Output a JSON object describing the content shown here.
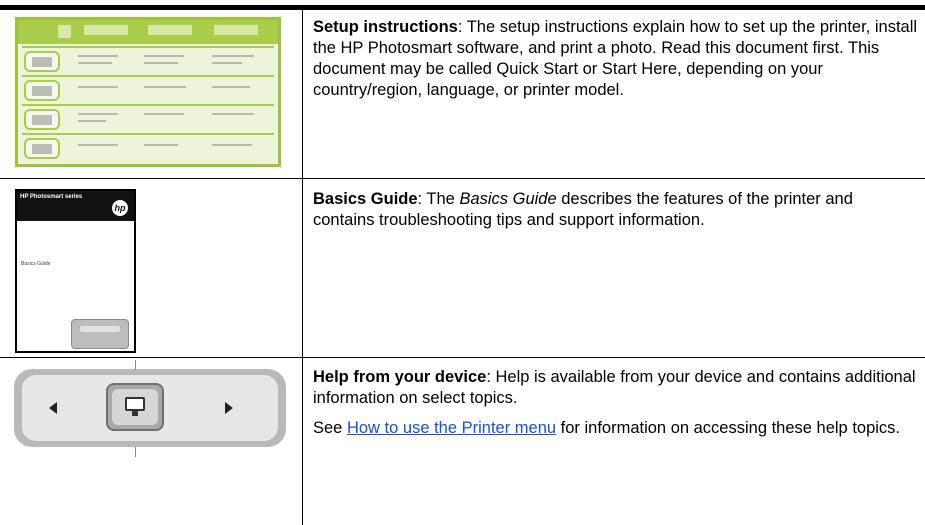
{
  "rows": [
    {
      "heading": "Setup instructions",
      "body": ": The setup instructions explain how to set up the printer, install the HP Photosmart software, and print a photo. Read this document first. This document may be called Quick Start or Start Here, depending on your country/region, language, or printer model."
    },
    {
      "heading": "Basics Guide",
      "body_pre": ": The ",
      "body_italic": "Basics Guide",
      "body_post": " describes the features of the printer and contains troubleshooting tips and support information."
    },
    {
      "heading": "Help from your device",
      "body": ": Help is available from your device and contains additional information on select topics.",
      "para2_pre": "See ",
      "para2_link": "How to use the Printer menu",
      "para2_post": " for information on accessing these help topics."
    }
  ],
  "icons": {
    "setup": "setup-poster-icon",
    "basics": "basics-guide-booklet-icon",
    "device": "printer-control-pad-icon"
  },
  "colors": {
    "poster_green": "#9cc33a",
    "link": "#1a4fd0"
  }
}
